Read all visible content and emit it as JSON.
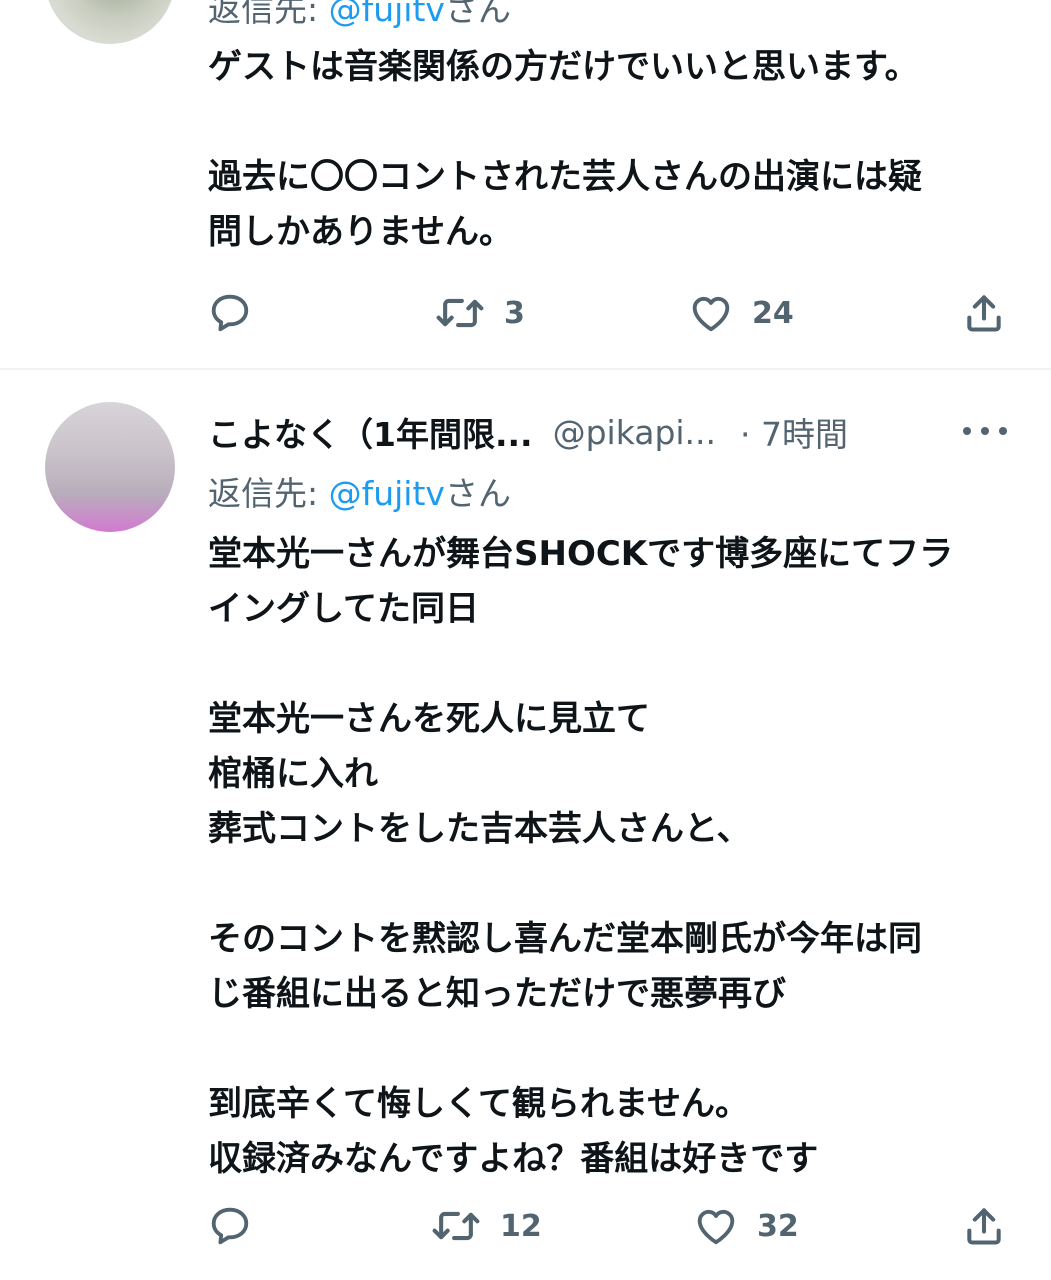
{
  "tweets": [
    {
      "reply_prefix": "返信先: ",
      "reply_handle": "@fujitv",
      "reply_suffix": "さん",
      "text": "ゲストは音楽関係の方だけでいいと思います。\n\n過去に〇〇コントされた芸人さんの出演には疑\n問しかありません。",
      "actions": {
        "replies": "",
        "retweets": "3",
        "likes": "24"
      }
    },
    {
      "display_name": "こよなく（1年間限...",
      "handle": "@pikapi...",
      "time": "· 7時間",
      "reply_prefix": "返信先: ",
      "reply_handle": "@fujitv",
      "reply_suffix": "さん",
      "text": "堂本光一さんが舞台SHOCKです博多座にてフラ\nイングしてた同日\n\n堂本光一さんを死人に見立て\n棺桶に入れ\n葬式コントをした吉本芸人さんと、\n\nそのコントを黙認し喜んだ堂本剛氏が今年は同\nじ番組に出ると知っただけで悪夢再び\n\n到底辛くて悔しくて観られません。\n収録済みなんですよね？番組は好きです",
      "actions": {
        "replies": "",
        "retweets": "12",
        "likes": "32"
      }
    }
  ],
  "icons": {
    "reply": "reply-icon",
    "retweet": "retweet-icon",
    "like": "heart-icon",
    "share": "share-icon",
    "more": "more-icon"
  },
  "colors": {
    "text": "#0f1419",
    "secondary": "#536471",
    "link": "#1d9bf0",
    "divider": "#eff3f4"
  }
}
